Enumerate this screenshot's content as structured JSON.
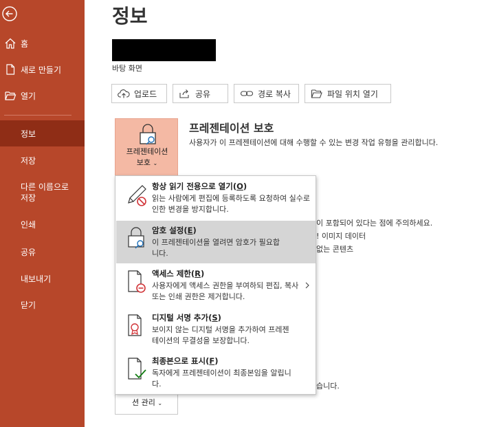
{
  "sidebar": {
    "items": [
      {
        "label": "홈",
        "icon": "home-icon"
      },
      {
        "label": "새로 만들기",
        "icon": "new-document-icon"
      },
      {
        "label": "열기",
        "icon": "folder-open-icon"
      },
      {
        "label": "정보",
        "active": true
      },
      {
        "label": "저장"
      },
      {
        "label": "다른 이름으로 저장"
      },
      {
        "label": "인쇄"
      },
      {
        "label": "공유"
      },
      {
        "label": "내보내기"
      },
      {
        "label": "닫기"
      }
    ]
  },
  "main": {
    "title": "정보",
    "location": "바탕 화면",
    "actions": [
      {
        "label": "업로드",
        "icon": "upload-icon"
      },
      {
        "label": "공유",
        "icon": "share-icon"
      },
      {
        "label": "경로 복사",
        "icon": "link-icon"
      },
      {
        "label": "파일 위치 열기",
        "icon": "folder-icon"
      }
    ],
    "protect": {
      "tile_label_line1": "프레젠테이션",
      "tile_label_line2": "보호",
      "heading": "프레젠테이션 보호",
      "description": "사용자가 이 프레젠테이션에 대해 수행할 수 있는 변경 작업 유형을 관리합니다."
    },
    "background_text": {
      "line1": "이 포함되어 있다는 점에 주의하세요.",
      "line2": "! 이미지 데이터",
      "line3": "없는 콘텐츠",
      "line4": "습니다."
    },
    "manage_tile_label": "션 관리"
  },
  "menu": {
    "items": [
      {
        "title": "항상 읽기 전용으로 열기",
        "key": "O",
        "description": "읽는 사람에게 편집에 등록하도록 요청하여 실수로 인한 변경을 방지합니다."
      },
      {
        "title": "암호 설정",
        "key": "E",
        "description": "이 프레젠테이션을 열려면 암호가 필요합니다.",
        "selected": true
      },
      {
        "title": "액세스 제한",
        "key": "R",
        "description": "사용자에게 액세스 권한을 부여하되 편집, 복사 또는 인쇄 권한은 제거합니다."
      },
      {
        "title": "디지털 서명 추가",
        "key": "S",
        "description": "보이지 않는 디지털 서명을 추가하여 프레젠테이션의 무결성을 보장합니다."
      },
      {
        "title": "최종본으로 표시",
        "key": "F",
        "description": "독자에게 프레젠테이션이 최종본임을 알립니다."
      }
    ]
  },
  "colors": {
    "sidebar": "#b7472a",
    "sidebar_active": "#8f2d16",
    "tile_accent": "#f4b9a4",
    "menu_selected": "#d5d5d5"
  }
}
